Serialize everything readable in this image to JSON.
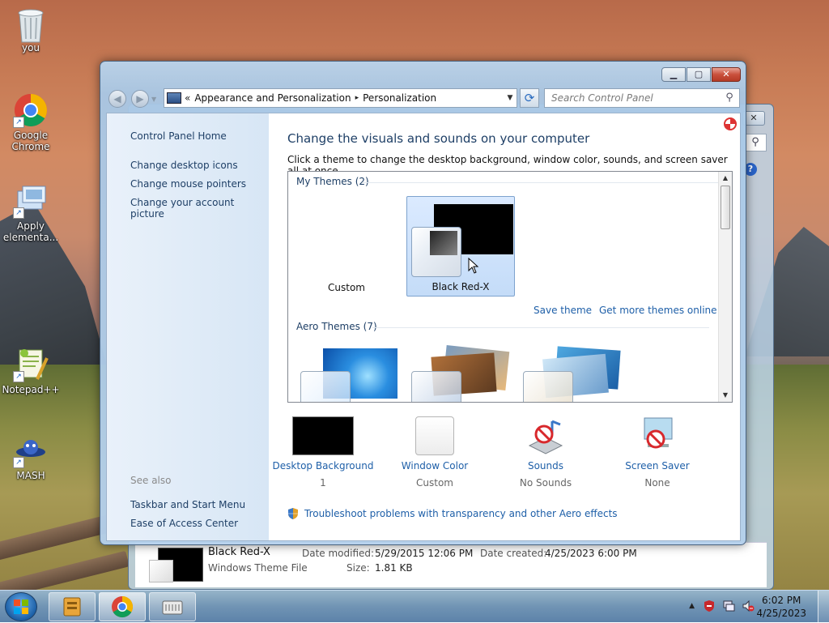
{
  "desktop": {
    "icons": [
      {
        "label": "you",
        "icon": "recycle-bin-icon"
      },
      {
        "label": "Google Chrome",
        "icon": "chrome-icon"
      },
      {
        "label": "Apply elementa...",
        "icon": "apply-icon"
      },
      {
        "label": "Notepad++",
        "icon": "notepadpp-icon"
      },
      {
        "label": "MASH",
        "icon": "mash-icon"
      }
    ]
  },
  "back_window": {
    "file": {
      "name": "Black Red-X",
      "type": "Windows Theme File",
      "date_modified_label": "Date modified:",
      "date_modified": "5/29/2015 12:06 PM",
      "date_created_label": "Date created:",
      "date_created": "4/25/2023 6:00 PM",
      "size_label": "Size:",
      "size": "1.81 KB"
    }
  },
  "window": {
    "caption": {
      "minimize": "▁",
      "maximize": "▢",
      "close": "✕"
    },
    "address": {
      "prefix": "«",
      "segments": [
        "Appearance and Personalization",
        "Personalization"
      ],
      "separator": "▸"
    },
    "search": {
      "placeholder": "Search Control Panel"
    },
    "left_nav": {
      "home": "Control Panel Home",
      "links": [
        "Change desktop icons",
        "Change mouse pointers",
        "Change your account picture"
      ],
      "see_also_heading": "See also",
      "see_also": [
        "Taskbar and Start Menu",
        "Ease of Access Center"
      ]
    },
    "main": {
      "title": "Change the visuals and sounds on your computer",
      "subtitle": "Click a theme to change the desktop background, window color, sounds, and screen saver all at once.",
      "my_themes_heading": "My Themes (2)",
      "my_themes": [
        {
          "name": "Custom",
          "selected": false
        },
        {
          "name": "Black Red-X",
          "selected": true
        }
      ],
      "save_theme": "Save theme",
      "get_more": "Get more themes online",
      "aero_heading": "Aero Themes (7)",
      "settings": [
        {
          "label": "Desktop Background",
          "value": "1",
          "icon": "desktop-background-thumb"
        },
        {
          "label": "Window Color",
          "value": "Custom",
          "icon": "window-color-thumb"
        },
        {
          "label": "Sounds",
          "value": "No Sounds",
          "icon": "sounds-icon"
        },
        {
          "label": "Screen Saver",
          "value": "None",
          "icon": "screen-saver-icon"
        }
      ],
      "troubleshoot": "Troubleshoot problems with transparency and other Aero effects"
    }
  },
  "taskbar": {
    "time": "6:02 PM",
    "date": "4/25/2023",
    "colors": {
      "selected_theme_bg": "#c4dcf8",
      "link": "#1e5fa8"
    }
  }
}
